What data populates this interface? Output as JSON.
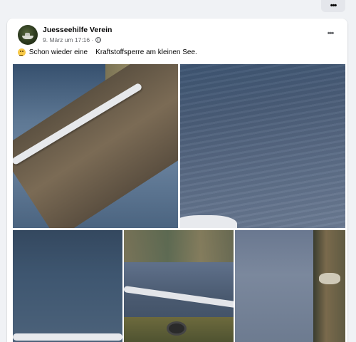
{
  "post": {
    "author": "Juesseehilfe Verein",
    "date": "9. März um 17:16 ·",
    "text": " Schon wieder eine    Kraftstoffsperre am kleinen See.",
    "emoji_icon": "thinking-face-emoji",
    "privacy_icon": "globe-icon",
    "photo_count": 5
  },
  "colors": {
    "page_bg": "#f0f2f5",
    "card_bg": "#ffffff",
    "name_text": "#050505",
    "meta_text": "#65676b"
  }
}
